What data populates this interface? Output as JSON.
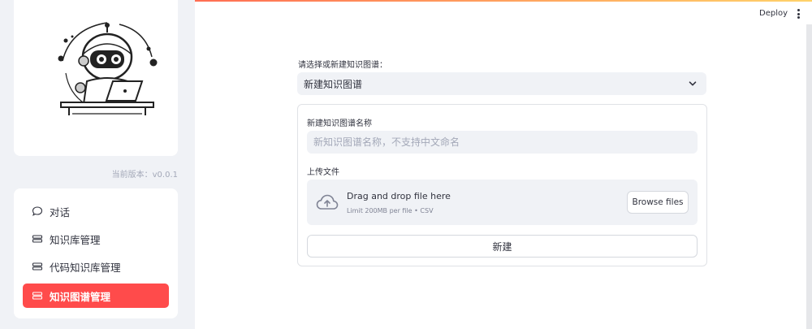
{
  "app": {
    "version_text": "当前版本：v0.0.1",
    "deploy_label": "Deploy",
    "accent_color": "#ff4b4b"
  },
  "sidebar": {
    "logo_icon": "robot-with-laptop-logo",
    "items": [
      {
        "label": "对话",
        "icon": "chat-bubble-icon",
        "active": false
      },
      {
        "label": "知识库管理",
        "icon": "database-icon",
        "active": false
      },
      {
        "label": "代码知识库管理",
        "icon": "database-icon",
        "active": false
      },
      {
        "label": "知识图谱管理",
        "icon": "database-icon",
        "active": true
      }
    ]
  },
  "main": {
    "select_label": "请选择或新建知识图谱：",
    "select_value": "新建知识图谱",
    "form": {
      "name_label": "新建知识图谱名称",
      "name_value": "",
      "name_placeholder": "新知识图谱名称，不支持中文命名",
      "upload_label": "上传文件",
      "upload_title": "Drag and drop file here",
      "upload_subtitle": "Limit 200MB per file • CSV",
      "browse_label": "Browse files",
      "submit_label": "新建"
    }
  }
}
